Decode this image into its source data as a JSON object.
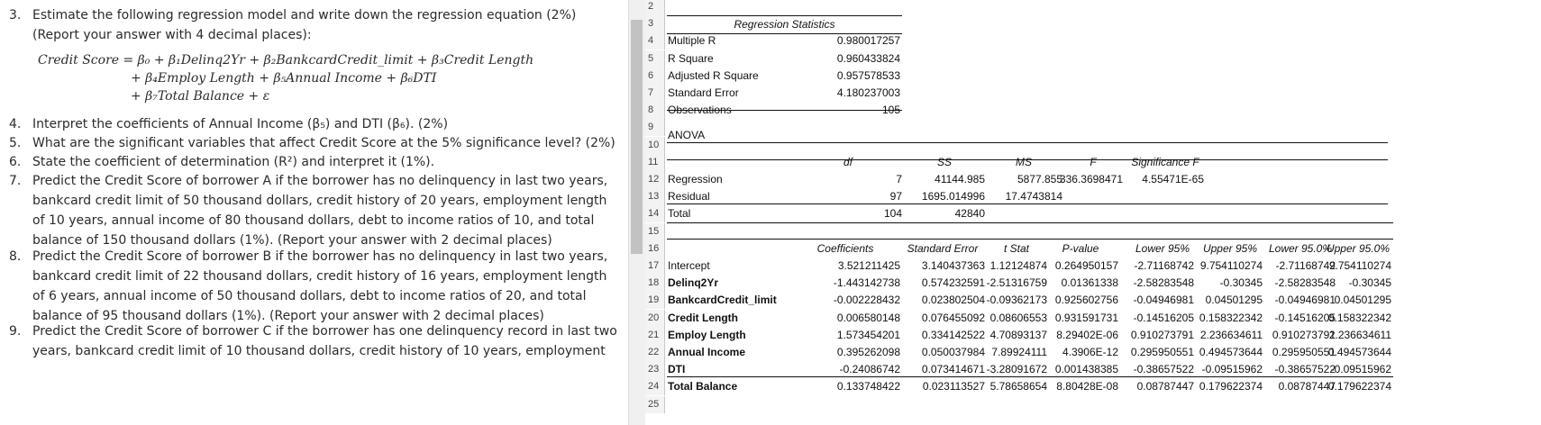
{
  "document": {
    "q3_number": "3.",
    "q3_text": "Estimate the following regression model and write down the regression equation (2%) (Report your answer with 4 decimal places):",
    "equation_line1": "Credit Score = β₀ + β₁Delinq2Yr + β₂BankcardCredit_limit + β₃Credit Length",
    "equation_line2": "+ β₄Employ Length + β₅Annual Income + β₆DTI",
    "equation_line3": "+ β₇Total Balance + ε",
    "q4_number": "4.",
    "q4_text": "Interpret the coefficients of Annual Income (β₅) and DTI (β₆). (2%)",
    "q5_number": "5.",
    "q5_text": "What are the significant variables that affect Credit Score at the 5% significance level? (2%)",
    "q6_number": "6.",
    "q6_text": "State the coefficient of determination (R²) and interpret it (1%).",
    "q7_number": "7.",
    "q7_text": "Predict the Credit Score of borrower A if the borrower has no delinquency in last two years, bankcard credit limit of 50 thousand dollars, credit history of 20 years, employment length of 10 years, annual income of 80 thousand dollars, debt to income ratios of 10, and total balance of 150 thousand dollars (1%). (Report your answer with 2 decimal places)",
    "q8_number": "8.",
    "q8_text": "Predict the Credit Score of borrower B if the borrower has no delinquency in last two years, bankcard credit limit of 22 thousand dollars, credit history of 16 years, employment length of 6 years, annual income of 50 thousand dollars, debt to income ratios of 20, and total balance of 95 thousand dollars (1%). (Report your answer with 2 decimal places)",
    "q9_number": "9.",
    "q9_text": "Predict the Credit Score of borrower C if the borrower has one delinquency record in last two years, bankcard credit limit of 10 thousand dollars, credit history of 10 years, employment"
  },
  "sheet": {
    "row_numbers": [
      "2",
      "3",
      "4",
      "5",
      "6",
      "7",
      "8",
      "9",
      "10",
      "11",
      "12",
      "13",
      "14",
      "15",
      "16",
      "17",
      "18",
      "19",
      "20",
      "21",
      "22",
      "23",
      "24",
      "25"
    ],
    "regression_statistics": {
      "title": "Regression Statistics",
      "rows": [
        {
          "label": "Multiple R",
          "value": "0.980017257"
        },
        {
          "label": "R Square",
          "value": "0.960433824"
        },
        {
          "label": "Adjusted R Square",
          "value": "0.957578533"
        },
        {
          "label": "Standard Error",
          "value": "4.180237003"
        },
        {
          "label": "Observations",
          "value": "105"
        }
      ]
    },
    "anova": {
      "title": "ANOVA",
      "headers": [
        "df",
        "SS",
        "MS",
        "F",
        "Significance F"
      ],
      "rows": [
        {
          "label": "Regression",
          "df": "7",
          "ss": "41144.985",
          "ms": "5877.855",
          "f": "336.3698471",
          "sigf": "4.55471E-65"
        },
        {
          "label": "Residual",
          "df": "97",
          "ss": "1695.014996",
          "ms": "17.4743814",
          "f": "",
          "sigf": ""
        },
        {
          "label": "Total",
          "df": "104",
          "ss": "42840",
          "ms": "",
          "f": "",
          "sigf": ""
        }
      ]
    },
    "coefficients": {
      "headers": [
        "Coefficients",
        "Standard Error",
        "t Stat",
        "P-value",
        "Lower 95%",
        "Upper 95%",
        "Lower 95.0%",
        "Upper 95.0%"
      ],
      "rows": [
        {
          "label": "Intercept",
          "bold": false,
          "values": [
            "3.521211425",
            "3.140437363",
            "1.12124874",
            "0.264950157",
            "-2.71168742",
            "9.754110274",
            "-2.71168742",
            "9.754110274"
          ]
        },
        {
          "label": "Delinq2Yr",
          "bold": true,
          "values": [
            "-1.443142738",
            "0.574232591",
            "-2.51316759",
            "0.01361338",
            "-2.58283548",
            "-0.30345",
            "-2.58283548",
            "-0.30345"
          ]
        },
        {
          "label": "BankcardCredit_limit",
          "bold": true,
          "values": [
            "-0.002228432",
            "0.023802504",
            "-0.09362173",
            "0.925602756",
            "-0.04946981",
            "0.04501295",
            "-0.04946981",
            "0.04501295"
          ]
        },
        {
          "label": "Credit Length",
          "bold": true,
          "values": [
            "0.006580148",
            "0.076455092",
            "0.08606553",
            "0.931591731",
            "-0.14516205",
            "0.158322342",
            "-0.14516205",
            "0.158322342"
          ]
        },
        {
          "label": "Employ Length",
          "bold": true,
          "values": [
            "1.573454201",
            "0.334142522",
            "4.70893137",
            "8.29402E-06",
            "0.910273791",
            "2.236634611",
            "0.910273791",
            "2.236634611"
          ]
        },
        {
          "label": "Annual Income",
          "bold": true,
          "values": [
            "0.395262098",
            "0.050037984",
            "7.89924111",
            "4.3906E-12",
            "0.295950551",
            "0.494573644",
            "0.295950551",
            "0.494573644"
          ]
        },
        {
          "label": "DTI",
          "bold": true,
          "values": [
            "-0.24086742",
            "0.073414671",
            "-3.28091672",
            "0.001438385",
            "-0.38657522",
            "-0.09515962",
            "-0.38657522",
            "-0.09515962"
          ]
        },
        {
          "label": "Total Balance",
          "bold": true,
          "values": [
            "0.133748422",
            "0.023113527",
            "5.78658654",
            "8.80428E-08",
            "0.08787447",
            "0.179622374",
            "0.08787447",
            "0.179622374"
          ]
        }
      ]
    }
  }
}
